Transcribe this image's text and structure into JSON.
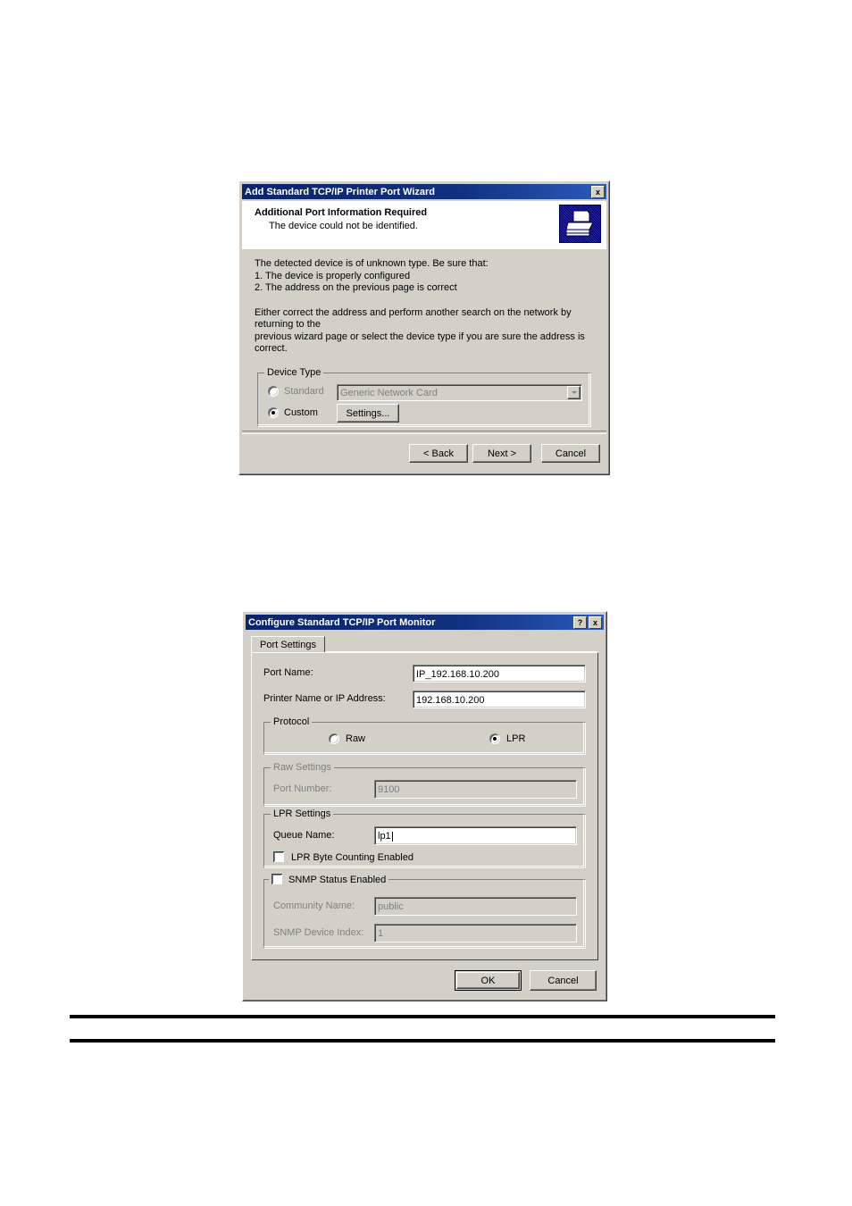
{
  "page": {
    "background": "#ffffff",
    "dialog_face_color": "#d4d0c8",
    "titlebar_color": "#0a246a",
    "disabled_text_color": "#808080"
  },
  "wizard": {
    "title": "Add Standard TCP/IP Printer Port Wizard",
    "close_label": "x",
    "header": {
      "heading": "Additional Port Information Required",
      "subheading": "The device could not be identified.",
      "icon": "printer-icon"
    },
    "body": {
      "paragraph1_line1": "The detected device is of unknown type.  Be sure that:",
      "paragraph1_line2": "1. The device is properly configured",
      "paragraph1_line3": "2.  The address on the previous page is correct",
      "paragraph2_line1": "Either correct the address and perform another search on the network by returning to the",
      "paragraph2_line2": "previous wizard page or select the device type if you are sure the address is correct."
    },
    "device_type": {
      "legend": "Device Type",
      "standard_label": "Standard",
      "standard_selected": false,
      "standard_combo_value": "Generic Network Card",
      "standard_combo_enabled": false,
      "custom_label": "Custom",
      "custom_selected": true,
      "settings_button": "Settings..."
    },
    "buttons": {
      "back": "< Back",
      "next": "Next >",
      "cancel": "Cancel"
    }
  },
  "port_monitor": {
    "title": "Configure Standard TCP/IP Port Monitor",
    "help_label": "?",
    "close_label": "x",
    "tab": "Port Settings",
    "fields": {
      "port_name_label": "Port Name:",
      "port_name_value": "IP_192.168.10.200",
      "printer_name_label": "Printer Name or IP Address:",
      "printer_name_value": "192.168.10.200"
    },
    "protocol": {
      "legend": "Protocol",
      "raw_label": "Raw",
      "raw_selected": false,
      "lpr_label": "LPR",
      "lpr_selected": true
    },
    "raw_settings": {
      "legend": "Raw Settings",
      "port_number_label": "Port Number:",
      "port_number_value": "9100",
      "enabled": false
    },
    "lpr_settings": {
      "legend": "LPR Settings",
      "queue_name_label": "Queue Name:",
      "queue_name_value": "lp1",
      "byte_counting_label": "LPR Byte Counting Enabled",
      "byte_counting_checked": false
    },
    "snmp": {
      "legend": "SNMP Status Enabled",
      "enabled": false,
      "community_name_label": "Community Name:",
      "community_name_value": "public",
      "device_index_label": "SNMP Device Index:",
      "device_index_value": "1"
    },
    "buttons": {
      "ok": "OK",
      "cancel": "Cancel"
    }
  }
}
